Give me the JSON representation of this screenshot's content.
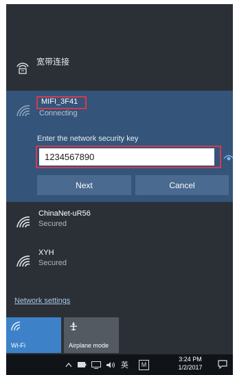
{
  "broadband": {
    "label": "宽带连接",
    "icon": "dialup-icon"
  },
  "selected_network": {
    "ssid": "MIFI_3F41",
    "status": "Connecting",
    "key_prompt": "Enter the network security key",
    "key_value": "1234567890",
    "next_label": "Next",
    "cancel_label": "Cancel"
  },
  "networks": [
    {
      "ssid": "ChinaNet-uR56",
      "security": "Secured",
      "icon": "wifi-icon"
    },
    {
      "ssid": "XYH",
      "security": "Secured",
      "icon": "wifi-icon"
    }
  ],
  "network_settings_label": "Network settings",
  "quick_actions": [
    {
      "label": "Wi-Fi",
      "icon": "wifi-icon",
      "active": true
    },
    {
      "label": "Airplane mode",
      "icon": "airplane-icon",
      "active": false
    }
  ],
  "taskbar": {
    "ime": "英",
    "ime_box": "M",
    "time": "3:24 PM",
    "date": "1/2/2017"
  },
  "colors": {
    "flyout_bg": "#2b3036",
    "selected_bg": "#34547a",
    "accent": "#3d82c8",
    "highlight_border": "#d33b4e"
  }
}
